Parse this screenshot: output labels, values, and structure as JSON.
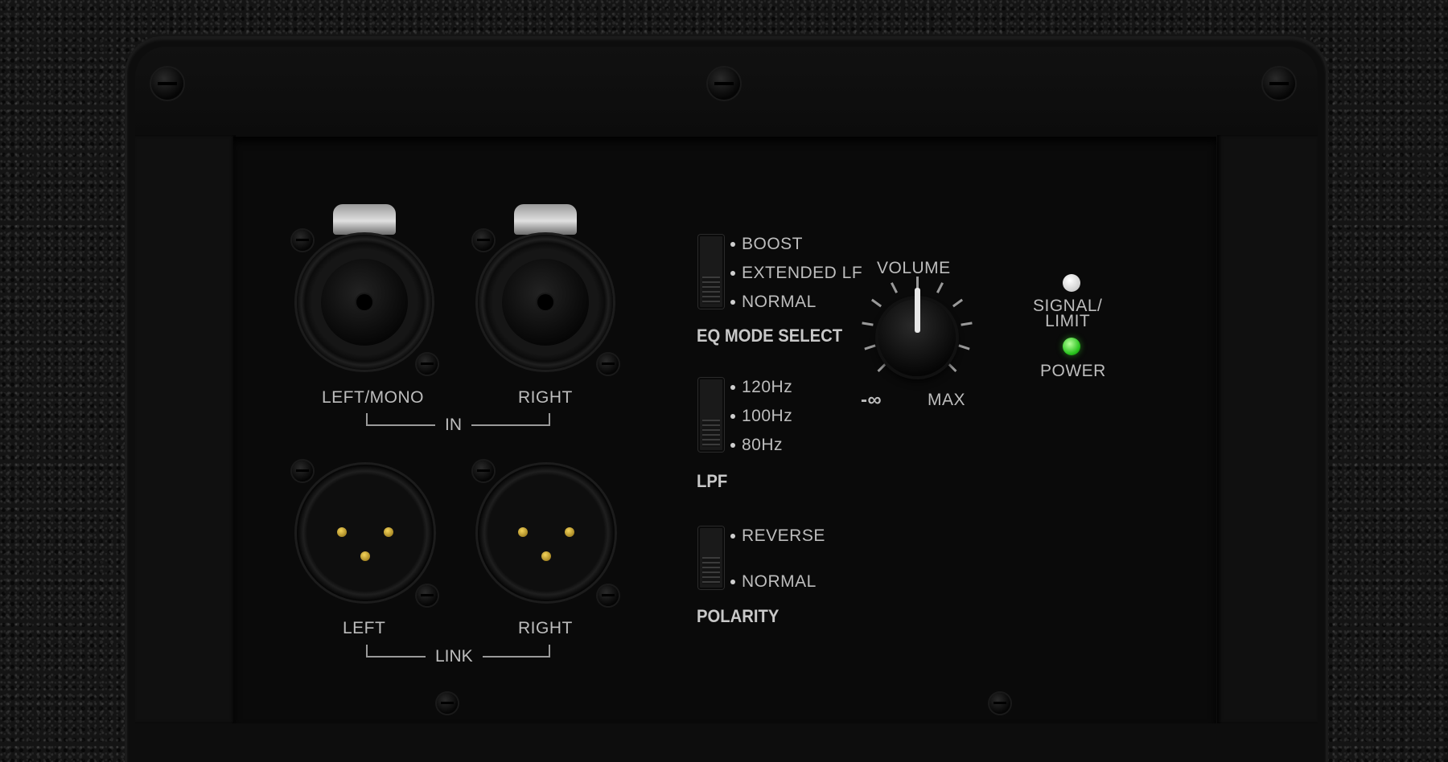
{
  "inputs": {
    "left_label": "LEFT/MONO",
    "right_label": "RIGHT",
    "group_label": "IN"
  },
  "link": {
    "left_label": "LEFT",
    "right_label": "RIGHT",
    "group_label": "LINK"
  },
  "eq_mode": {
    "title": "EQ MODE SELECT",
    "options": [
      "BOOST",
      "EXTENDED LF",
      "NORMAL"
    ],
    "selected": "NORMAL"
  },
  "lpf": {
    "title": "LPF",
    "options": [
      "120Hz",
      "100Hz",
      "80Hz"
    ],
    "selected": "80Hz"
  },
  "polarity": {
    "title": "POLARITY",
    "options": [
      "REVERSE",
      "NORMAL"
    ],
    "selected": "NORMAL"
  },
  "volume": {
    "title": "VOLUME",
    "min_label": "-∞",
    "max_label": "MAX",
    "level": 0.5
  },
  "indicators": {
    "signal_label_1": "SIGNAL/",
    "signal_label_2": "LIMIT",
    "power_label": "POWER",
    "power_color": "#2ad61f",
    "signal_color": "#f0f0f0"
  }
}
